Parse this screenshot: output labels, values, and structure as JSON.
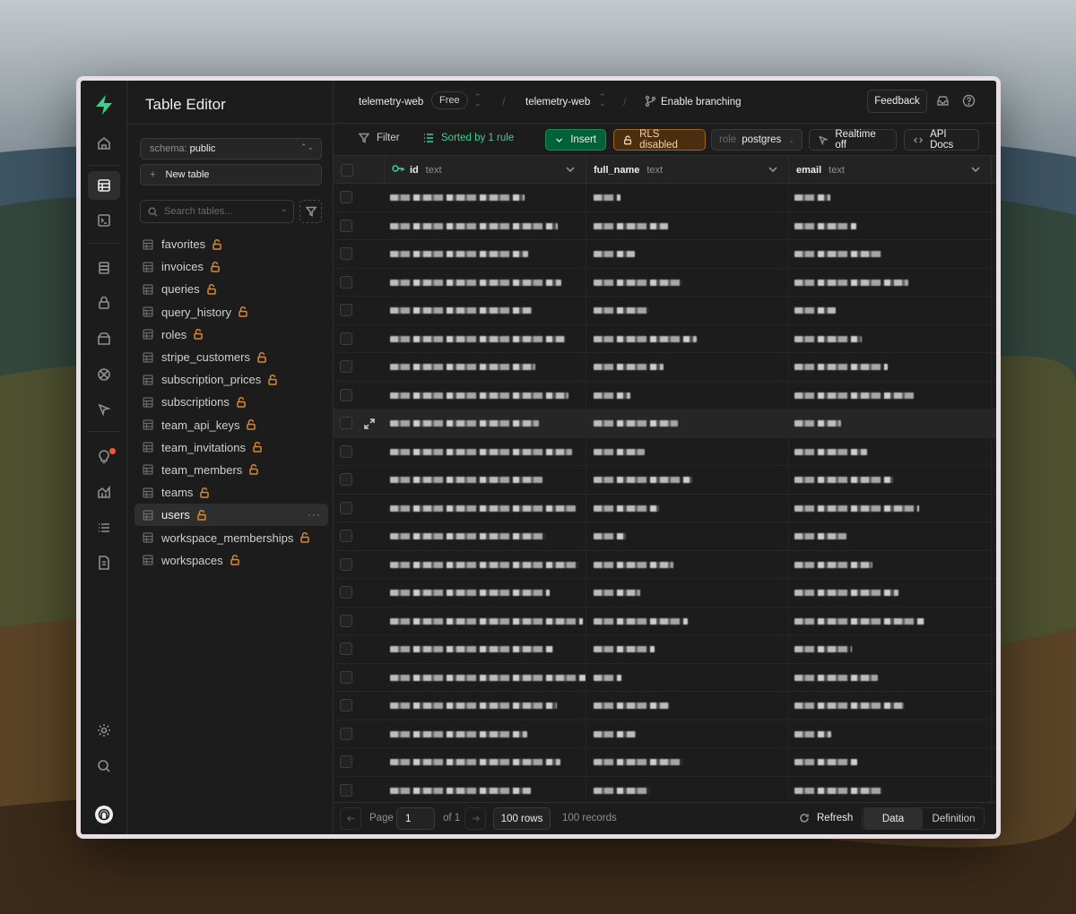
{
  "app": {
    "title": "Table Editor"
  },
  "header": {
    "project": "telemetry-web",
    "plan_badge": "Free",
    "branch": "telemetry-web",
    "enable_branching": "Enable branching",
    "feedback": "Feedback"
  },
  "sidebar": {
    "schema_label": "schema:",
    "schema_value": "public",
    "new_table": "New table",
    "search_placeholder": "Search tables...",
    "tables": [
      {
        "label": "favorites"
      },
      {
        "label": "invoices"
      },
      {
        "label": "queries"
      },
      {
        "label": "query_history"
      },
      {
        "label": "roles"
      },
      {
        "label": "stripe_customers"
      },
      {
        "label": "subscription_prices"
      },
      {
        "label": "subscriptions"
      },
      {
        "label": "team_api_keys"
      },
      {
        "label": "team_invitations"
      },
      {
        "label": "team_members"
      },
      {
        "label": "teams"
      },
      {
        "label": "users",
        "active": true
      },
      {
        "label": "workspace_memberships"
      },
      {
        "label": "workspaces"
      }
    ]
  },
  "toolbar": {
    "filter": "Filter",
    "sorted": "Sorted by 1 rule",
    "insert": "Insert",
    "rls": "RLS disabled",
    "role_label": "role",
    "role_value": "postgres",
    "realtime": "Realtime off",
    "api_docs": "API Docs"
  },
  "grid": {
    "columns": [
      {
        "name": "id",
        "type": "text",
        "primary_key": true
      },
      {
        "name": "full_name",
        "type": "text"
      },
      {
        "name": "email",
        "type": "text"
      }
    ],
    "visible_rows": 22,
    "row_values_obscured": true
  },
  "footer": {
    "page_label": "Page",
    "page_value": "1",
    "of_label": "of 1",
    "rows": "100 rows",
    "records": "100 records",
    "refresh": "Refresh",
    "view_data": "Data",
    "view_definition": "Definition"
  },
  "colors": {
    "accent": "#3ecf8e",
    "rls_warning": "#d68933",
    "background": "#1c1c1c"
  }
}
